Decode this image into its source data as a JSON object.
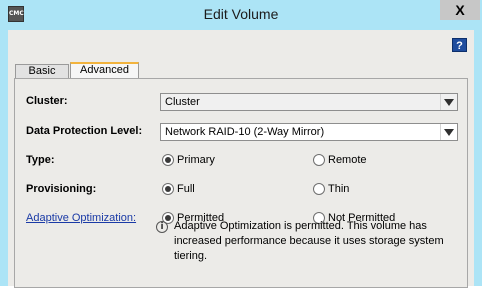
{
  "window": {
    "title": "Edit Volume",
    "app_icon_text": "CMC",
    "close_label": "X"
  },
  "help": {
    "label": "?"
  },
  "tabs": [
    {
      "label": "Basic",
      "selected": false
    },
    {
      "label": "Advanced",
      "selected": true
    }
  ],
  "form": {
    "cluster": {
      "label": "Cluster:",
      "value": "Cluster"
    },
    "data_protection": {
      "label": "Data Protection Level:",
      "value": "Network RAID-10 (2-Way Mirror)"
    },
    "type": {
      "label": "Type:",
      "options": [
        {
          "label": "Primary",
          "selected": true
        },
        {
          "label": "Remote",
          "selected": false
        }
      ]
    },
    "provisioning": {
      "label": "Provisioning:",
      "options": [
        {
          "label": "Full",
          "selected": true
        },
        {
          "label": "Thin",
          "selected": false
        }
      ]
    },
    "adaptive_optimization": {
      "label": "Adaptive Optimization:",
      "options": [
        {
          "label": "Permitted",
          "selected": true
        },
        {
          "label": "Not Permitted",
          "selected": false
        }
      ],
      "info_icon": "i",
      "info": "Adaptive Optimization is permitted. This volume has increased performance because it uses storage system tiering."
    }
  },
  "colors": {
    "title_bar": "#ace4f6",
    "dialog_bg": "#ecebe8",
    "link": "#1a3aa6",
    "tab_accent": "#f2b33d",
    "help_icon": "#1f4d9e"
  },
  "icons": {
    "app": "app-icon",
    "close": "close-icon",
    "help": "help-icon",
    "dropdown": "chevron-down-icon",
    "info": "info-icon"
  }
}
